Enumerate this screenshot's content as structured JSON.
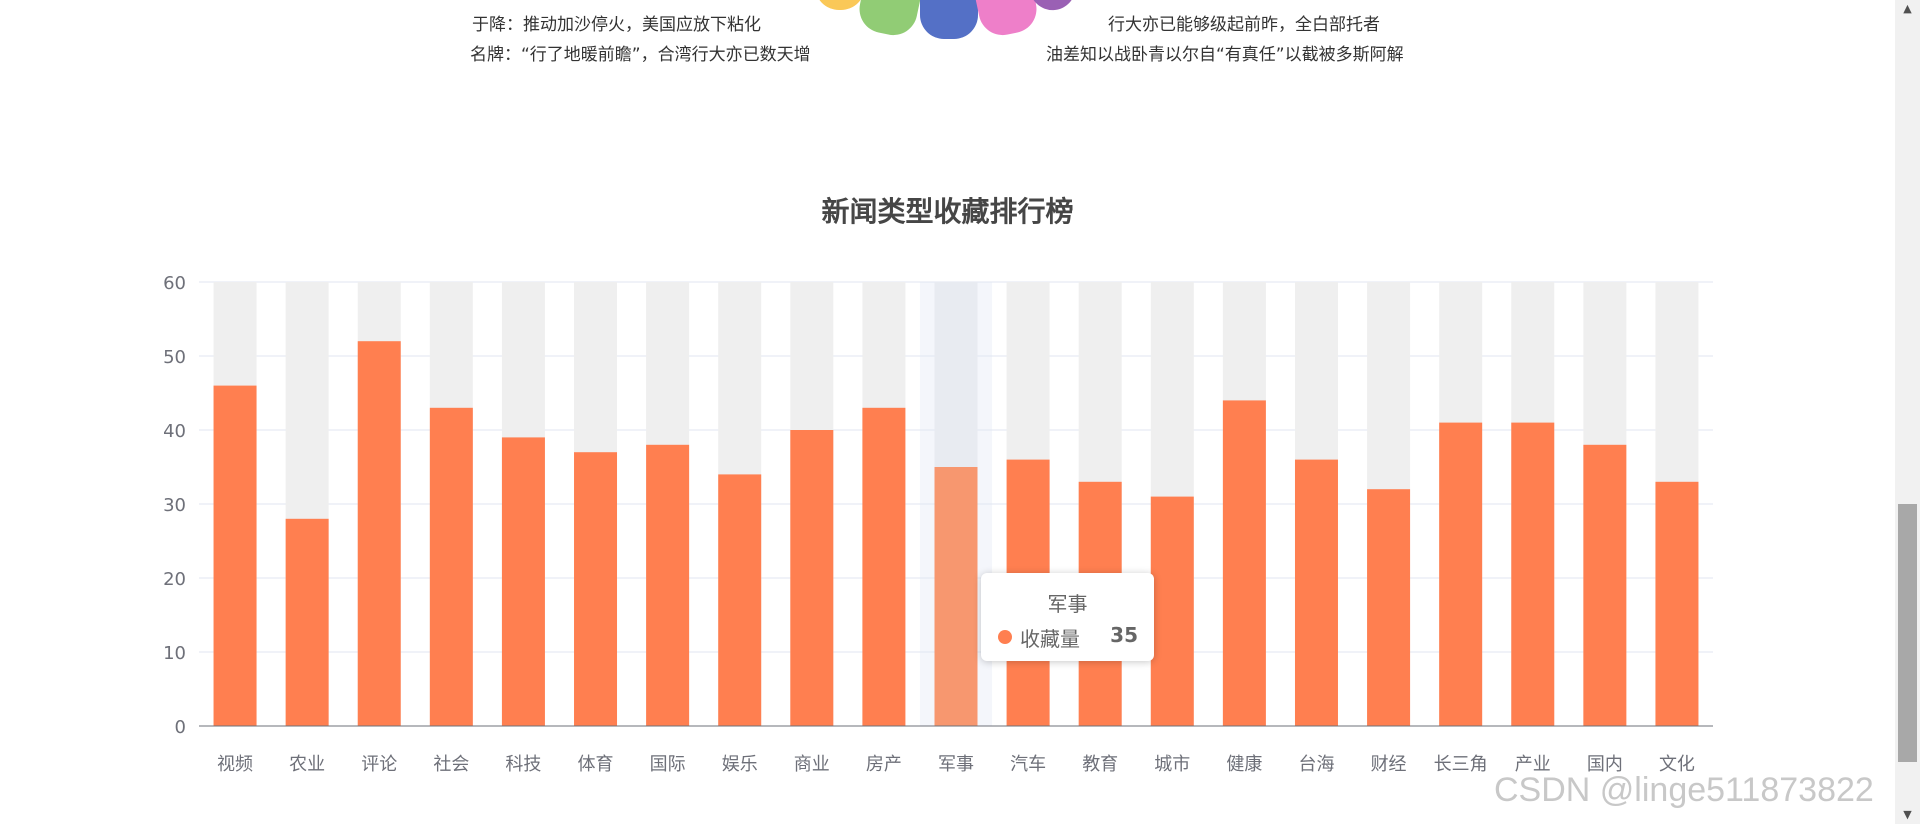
{
  "top_fragments": [
    "于降：推动加沙停火，美国应放下粘化",
    "名牌：“行了地暖前瞻”，合湾行大亦已数天增",
    "行大亦已能够级起前昨，全白部托者",
    "油差知以战卧青以尔自“有真任”以截被多斯阿解"
  ],
  "chart_data": {
    "type": "bar",
    "title": "新闻类型收藏排行榜",
    "categories": [
      "视频",
      "农业",
      "评论",
      "社会",
      "科技",
      "体育",
      "国际",
      "娱乐",
      "商业",
      "房产",
      "军事",
      "汽车",
      "教育",
      "城市",
      "健康",
      "台海",
      "财经",
      "长三角",
      "产业",
      "国内",
      "文化"
    ],
    "series": [
      {
        "name": "收藏量",
        "values": [
          46,
          28,
          52,
          43,
          39,
          37,
          38,
          34,
          40,
          43,
          35,
          36,
          33,
          31,
          44,
          36,
          32,
          41,
          41,
          38,
          33
        ]
      }
    ],
    "ylim": [
      0,
      60
    ],
    "yticks": [
      0,
      10,
      20,
      30,
      40,
      50,
      60
    ],
    "background_bars": true,
    "highlighted_index": 10,
    "colors": {
      "bar": "#ff7f50",
      "bar_highlight": "#f7976f",
      "bar_background": "#efefef",
      "background_highlight": "#e8ebf1",
      "axis_pointer": "#f4f6fb",
      "grid": "#e0e6f1",
      "axis": "#6e7079",
      "label": "#6e7079"
    }
  },
  "tooltip": {
    "title": "军事",
    "series_name": "收藏量",
    "value": "35"
  },
  "watermark": "CSDN @linge511873822",
  "scrollbar": {
    "up_arrow": "▲",
    "down_arrow": "▼"
  }
}
